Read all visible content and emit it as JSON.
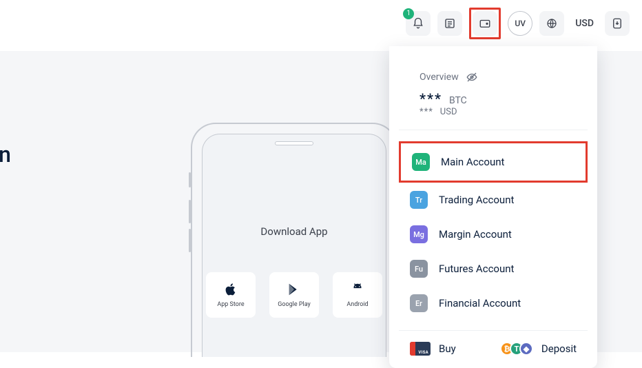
{
  "topbar": {
    "notification_count": "1",
    "avatar_initials": "UV",
    "currency": "USD"
  },
  "hero": {
    "partial_text": "in"
  },
  "download": {
    "title": "Download App",
    "stores": [
      {
        "label": "App Store"
      },
      {
        "label": "Google Play"
      },
      {
        "label": "Android"
      }
    ]
  },
  "panel": {
    "overview_label": "Overview",
    "masked_primary": "***",
    "primary_ccy": "BTC",
    "masked_secondary": "***",
    "secondary_ccy": "USD",
    "accounts": [
      {
        "badge": "Ma",
        "color": "#1fb37a",
        "label": "Main Account"
      },
      {
        "badge": "Tr",
        "color": "#4aa3e0",
        "label": "Trading Account"
      },
      {
        "badge": "Mg",
        "color": "#7a6fe0",
        "label": "Margin Account"
      },
      {
        "badge": "Fu",
        "color": "#8a93a0",
        "label": "Futures Account"
      },
      {
        "badge": "Er",
        "color": "#9aa2ae",
        "label": "Financial Account"
      }
    ],
    "footer": {
      "buy_label": "Buy",
      "card_brand": "VISA",
      "deposit_label": "Deposit"
    }
  }
}
